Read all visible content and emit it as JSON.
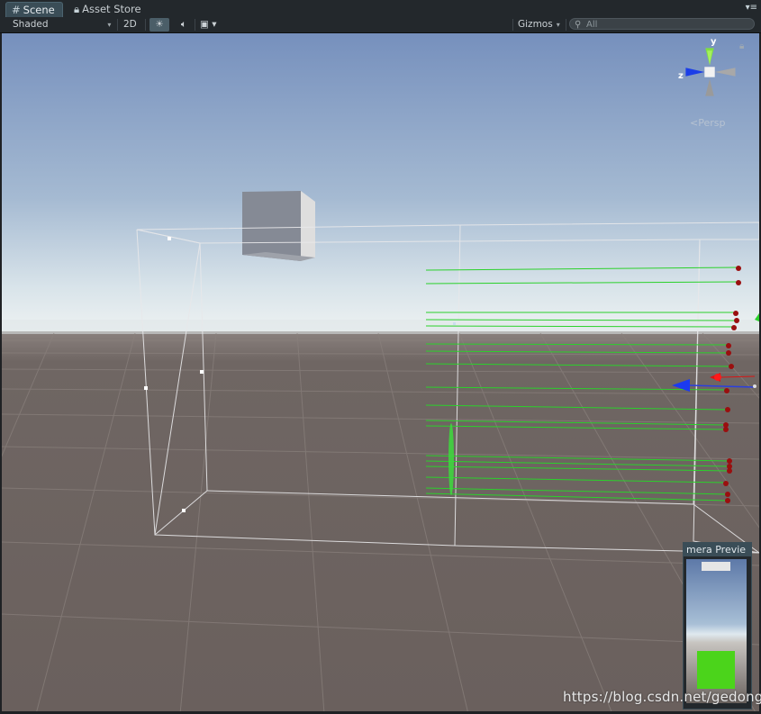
{
  "tabs": [
    {
      "label": "Scene",
      "icon": "grid-icon",
      "active": true
    },
    {
      "label": "Asset Store",
      "icon": "bag-icon",
      "active": false
    }
  ],
  "toolbar": {
    "shading_mode": "Shaded",
    "mode_2d": "2D",
    "gizmos": "Gizmos",
    "search_placeholder": "All"
  },
  "viewport": {
    "projection_label": "Persp",
    "axis_labels": {
      "y": "y",
      "z": "z"
    }
  },
  "camera_preview": {
    "title": "mera Previe"
  },
  "watermark": "https://blog.csdn.net/gedongxi",
  "colors": {
    "ui_dark": "#23282c",
    "tab_active": "#3a4d57",
    "green_ray": "#1fd21f",
    "hit_marker": "#9a0f0f",
    "sky_top": "#7a94bf",
    "ground": "#6b625f"
  }
}
